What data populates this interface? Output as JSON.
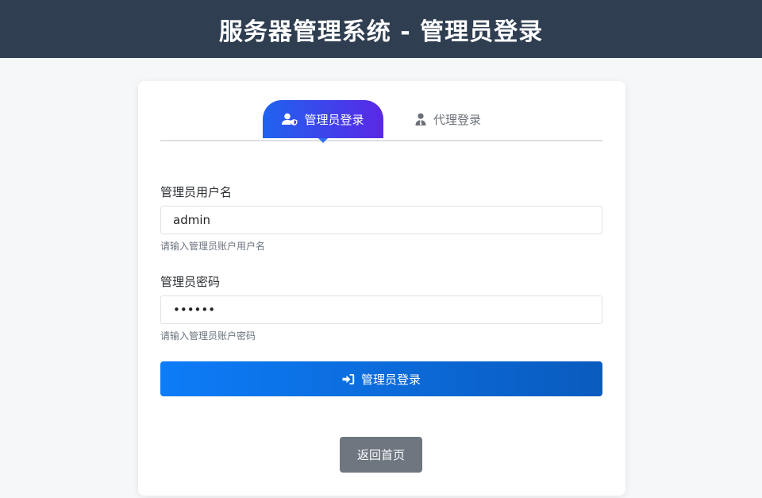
{
  "header": {
    "title": "服务器管理系统 - 管理员登录"
  },
  "tabs": [
    {
      "label": "管理员登录",
      "icon": "user-shield-icon",
      "active": true
    },
    {
      "label": "代理登录",
      "icon": "user-tie-icon",
      "active": false
    }
  ],
  "form": {
    "username": {
      "label": "管理员用户名",
      "value": "admin",
      "hint": "请输入管理员账户用户名"
    },
    "password": {
      "label": "管理员密码",
      "value": "••••••",
      "hint": "请输入管理员账户密码"
    },
    "submit": {
      "label": "管理员登录",
      "icon": "sign-in-icon"
    }
  },
  "back_button": {
    "label": "返回首页"
  },
  "colors": {
    "header_bg": "#2f3e50",
    "tab_gradient_start": "#1f63f0",
    "tab_gradient_end": "#5a28e6",
    "submit_gradient_start": "#0d7cf8",
    "submit_gradient_end": "#0a5bbe",
    "back_button_bg": "#6e7780"
  }
}
